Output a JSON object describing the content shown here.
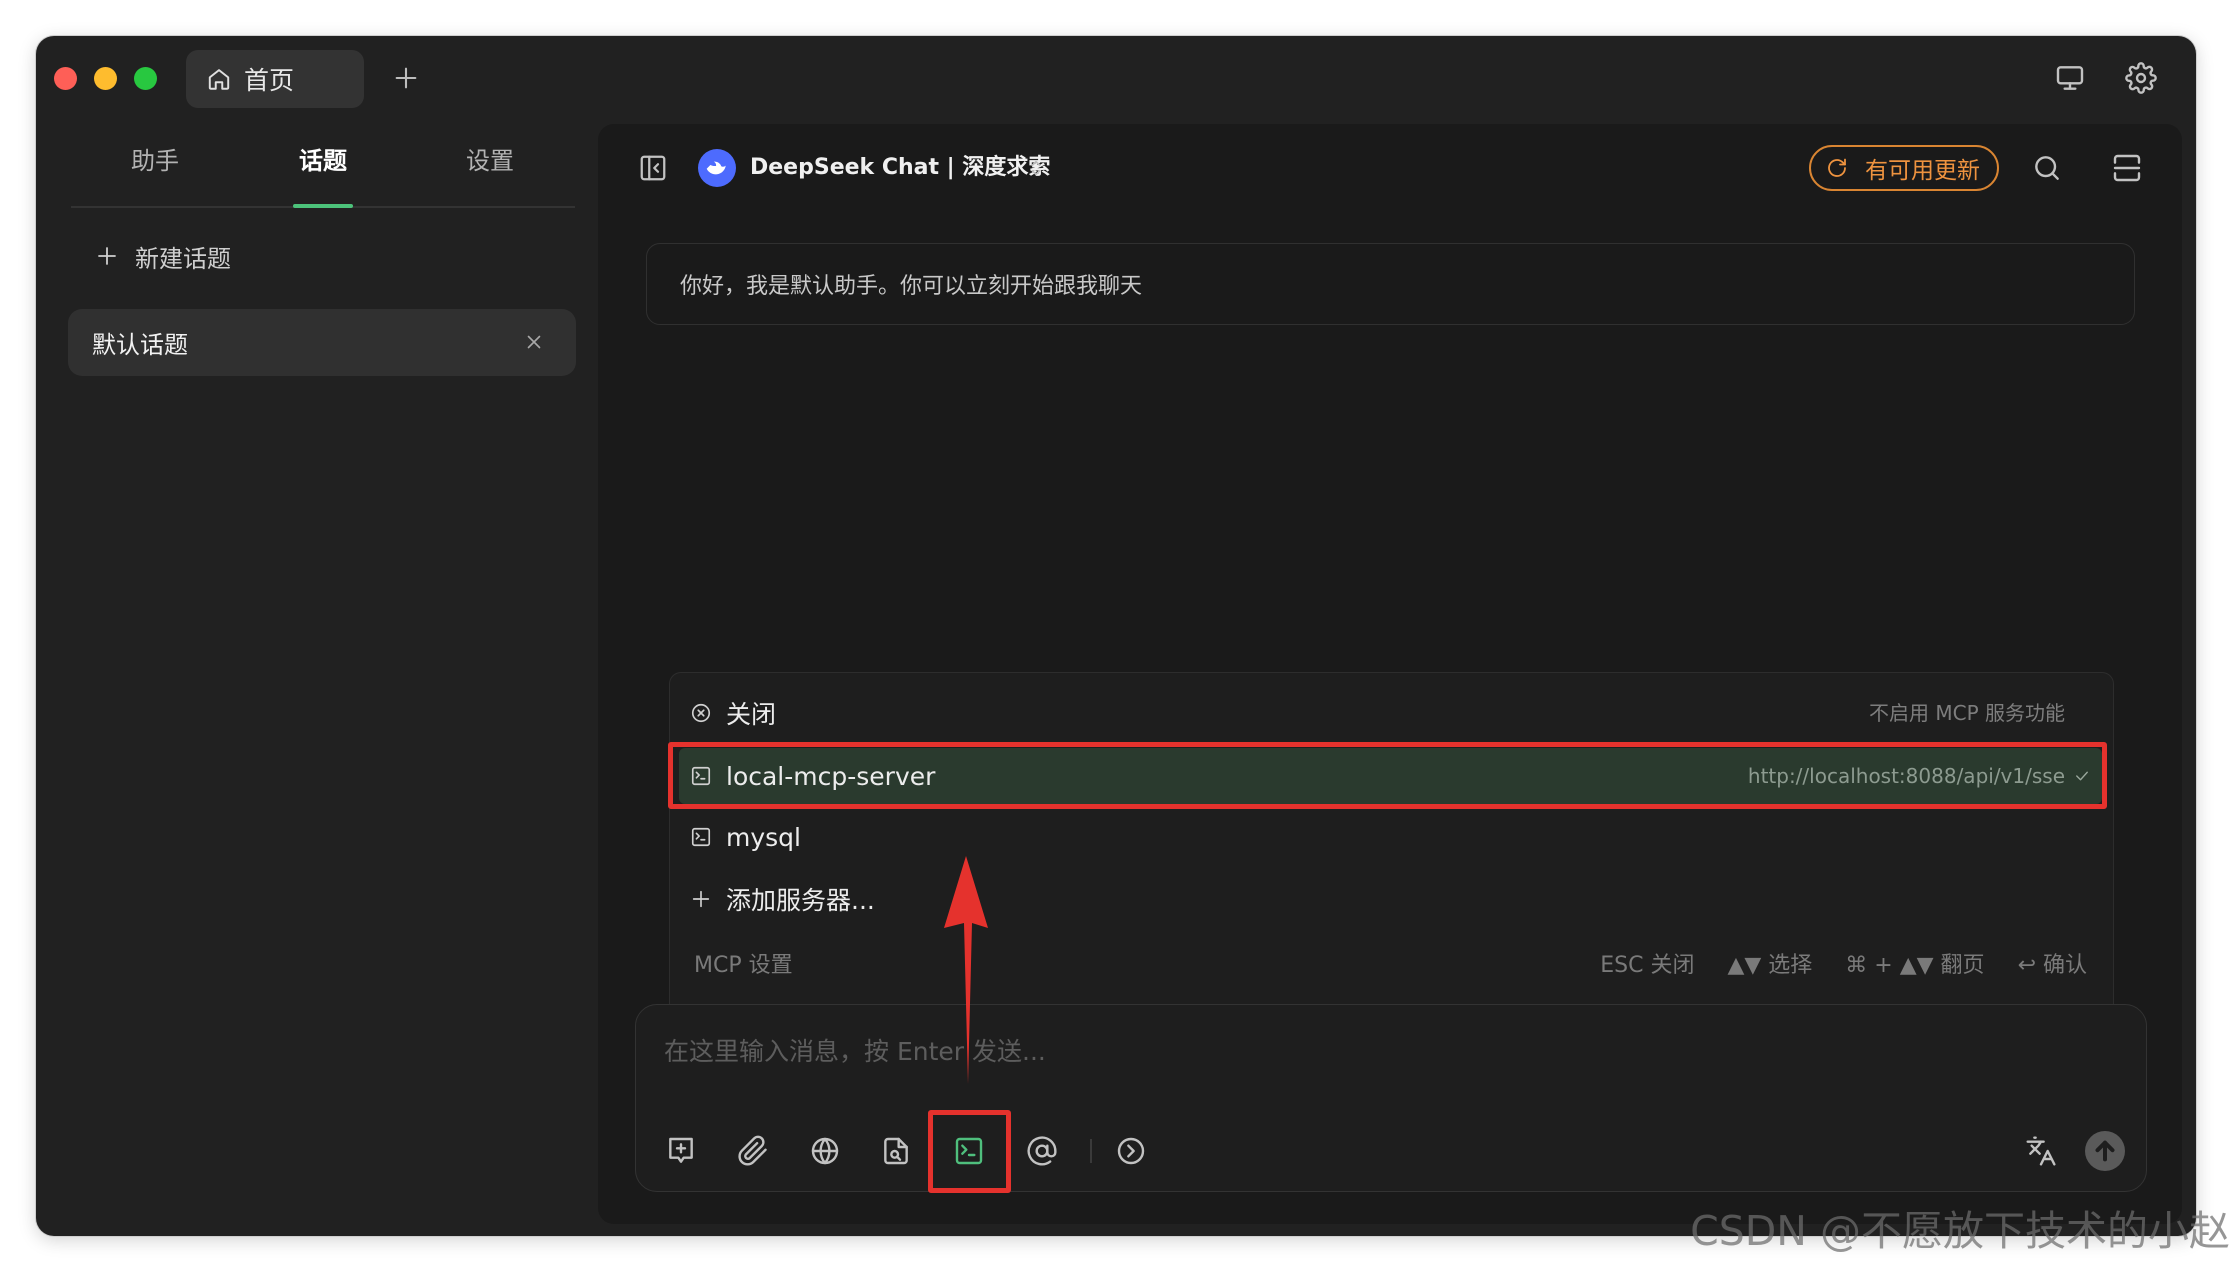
{
  "window": {
    "tabs": [
      {
        "label": "首页",
        "icon": "home-icon"
      }
    ],
    "traffic_lights": {
      "close": "#fe5f57",
      "minimize": "#febc2e",
      "zoom": "#28c840"
    },
    "titlebar_icons": [
      "plus-icon",
      "monitor-icon",
      "gear-icon"
    ]
  },
  "sidebar": {
    "tabs": [
      {
        "label": "助手"
      },
      {
        "label": "话题",
        "active": true
      },
      {
        "label": "设置"
      }
    ],
    "new_topic_label": "新建话题",
    "topics": [
      {
        "label": "默认话题",
        "selected": true
      }
    ]
  },
  "header": {
    "model_name": "DeepSeek Chat | 深度求索",
    "update_label": "有可用更新",
    "icons": [
      "sidebar-toggle-icon",
      "chevron-up-down-icon",
      "refresh-icon",
      "search-icon",
      "scan-icon"
    ]
  },
  "messages": [
    {
      "text": "你好，我是默认助手。你可以立刻开始跟我聊天"
    }
  ],
  "mcp_menu": {
    "items": [
      {
        "label": "关闭",
        "hint": "不启用 MCP 服务功能",
        "icon": "close-circle-icon"
      },
      {
        "label": "local-mcp-server",
        "hint": "http://localhost:8088/api/v1/sse",
        "icon": "terminal-icon",
        "selected": true
      },
      {
        "label": "mysql",
        "icon": "terminal-icon"
      },
      {
        "label": "添加服务器...",
        "icon": "plus-icon"
      }
    ],
    "footer": {
      "settings_label": "MCP 设置",
      "shortcuts": [
        "ESC 关闭",
        "▲▼ 选择",
        "⌘ + ▲▼ 翻页",
        "↩ 确认"
      ]
    }
  },
  "composer": {
    "placeholder": "在这里输入消息，按 Enter 发送...",
    "tools": [
      "new-topic-icon",
      "paperclip-icon",
      "globe-icon",
      "file-search-icon",
      "terminal-icon",
      "at-icon",
      "chevron-circle-icon"
    ],
    "right_tools": [
      "translate-icon",
      "send-icon"
    ]
  },
  "theme": {
    "accent_green": "#4cc27a",
    "update_orange": "#ee933f",
    "annotation_red": "#e5322d"
  },
  "watermark": "CSDN @不愿放下技术的小赵"
}
